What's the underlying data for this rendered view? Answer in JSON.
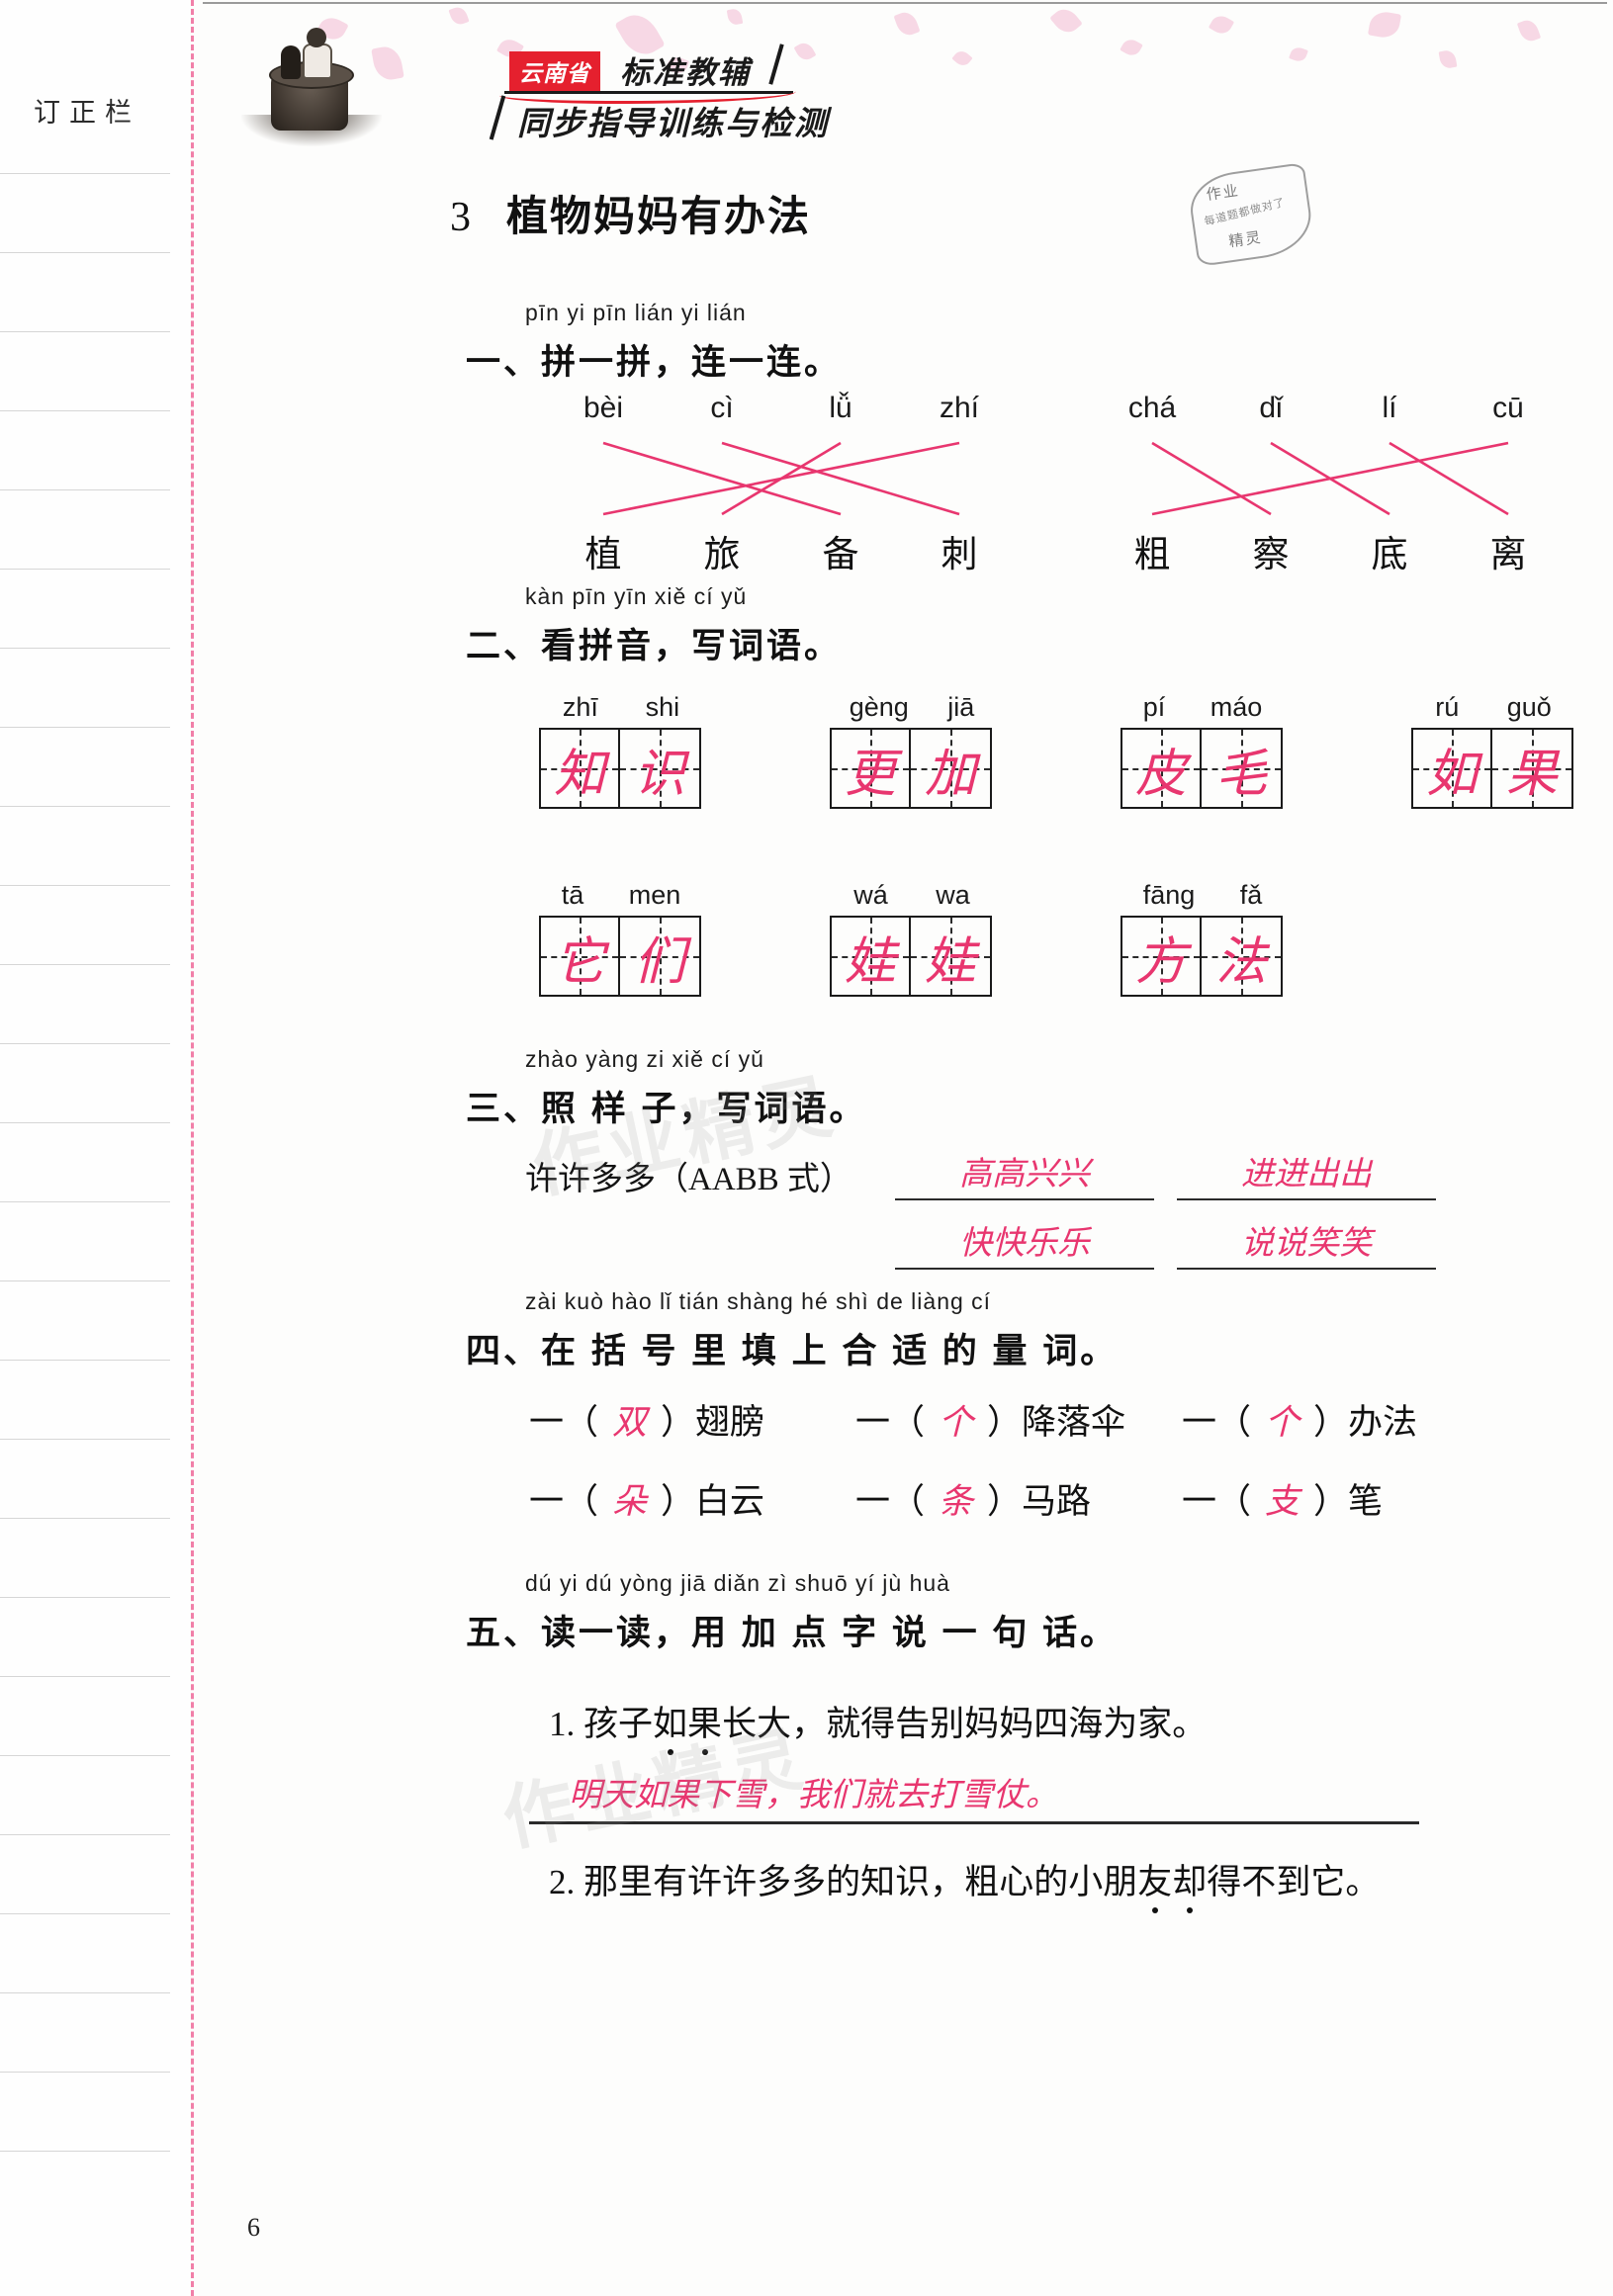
{
  "margin": {
    "title": "订正栏",
    "rule_count": 26
  },
  "header": {
    "brand_region": "云南省",
    "brand_main": "标准教辅",
    "brand_sub": "同步指导训练与检测",
    "illustration": "boy-on-tree-stump-with-cat"
  },
  "lesson": {
    "number": "3",
    "title": "植物妈妈有办法"
  },
  "stamp": {
    "line1": "作业",
    "line2": "每道题都做对了",
    "line3": "精灵"
  },
  "sections": [
    {
      "id": "one",
      "pinyin": "pīn yi pīn   lián yi lián",
      "heading": "一、拼一拼，连一连。"
    },
    {
      "id": "two",
      "pinyin": "kàn pīn yīn    xiě cí yǔ",
      "heading": "二、看拼音，写词语。"
    },
    {
      "id": "three",
      "pinyin": "zhào yàng zi    xiě cí yǔ",
      "heading": "三、照 样 子，写词语。"
    },
    {
      "id": "four",
      "pinyin": "zài kuò hào  lǐ  tián shàng hé shì de liàng cí",
      "heading": "四、在 括 号 里 填 上 合 适 的 量 词。"
    },
    {
      "id": "five",
      "pinyin": "dú yi dú     yòng jiā diǎn zì shuō yí jù huà",
      "heading": "五、读一读，用 加 点 字 说 一 句 话。"
    }
  ],
  "matching": {
    "left_pinyin": [
      "bèi",
      "cì",
      "lǚ",
      "zhí"
    ],
    "left_hanzi": [
      "植",
      "旅",
      "备",
      "刺"
    ],
    "right_pinyin": [
      "chá",
      "dǐ",
      "lí",
      "cū"
    ],
    "right_hanzi": [
      "粗",
      "察",
      "底",
      "离"
    ],
    "left_links": [
      [
        0,
        2
      ],
      [
        1,
        3
      ],
      [
        2,
        1
      ],
      [
        3,
        0
      ]
    ],
    "right_links": [
      [
        0,
        1
      ],
      [
        1,
        2
      ],
      [
        2,
        3
      ],
      [
        3,
        0
      ]
    ],
    "line_color": "#e8366f"
  },
  "word_grids": {
    "row1": [
      {
        "pinyin": [
          "zhī",
          "shi"
        ],
        "chars": [
          "知",
          "识"
        ]
      },
      {
        "pinyin": [
          "gèng",
          "jiā"
        ],
        "chars": [
          "更",
          "加"
        ]
      },
      {
        "pinyin": [
          "pí",
          "máo"
        ],
        "chars": [
          "皮",
          "毛"
        ]
      },
      {
        "pinyin": [
          "rú",
          "guǒ"
        ],
        "chars": [
          "如",
          "果"
        ]
      }
    ],
    "row2": [
      {
        "pinyin": [
          "tā",
          "men"
        ],
        "chars": [
          "它",
          "们"
        ]
      },
      {
        "pinyin": [
          "wá",
          "wa"
        ],
        "chars": [
          "娃",
          "娃"
        ]
      },
      {
        "pinyin": [
          "fāng",
          "fǎ"
        ],
        "chars": [
          "方",
          "法"
        ]
      }
    ]
  },
  "aabb": {
    "prompt": "许许多多（AABB 式）",
    "answers": [
      "高高兴兴",
      "进进出出",
      "快快乐乐",
      "说说笑笑"
    ]
  },
  "measure_words": {
    "row1": [
      {
        "prefix": "一（",
        "answer": "双",
        "suffix": "）翅膀"
      },
      {
        "prefix": "一（",
        "answer": "个",
        "suffix": "）降落伞"
      },
      {
        "prefix": "一（",
        "answer": "个",
        "suffix": "）办法"
      }
    ],
    "row2": [
      {
        "prefix": "一（",
        "answer": "朵",
        "suffix": "）白云"
      },
      {
        "prefix": "一（",
        "answer": "条",
        "suffix": "）马路"
      },
      {
        "prefix": "一（",
        "answer": "支",
        "suffix": "）笔"
      }
    ]
  },
  "sentences": [
    {
      "num": "1.",
      "text": "孩子如果长大，就得告别妈妈四海为家。",
      "answer": "明天如果下雪，我们就去打雪仗。"
    },
    {
      "num": "2.",
      "text": "那里有许许多多的知识，粗心的小朋友却得不到它。",
      "answer": ""
    }
  ],
  "watermarks": [
    "作业精灵",
    "作业精灵"
  ],
  "page_number": "6",
  "colors": {
    "handwriting": "#e8366f",
    "brand_red": "#e5202e",
    "tear_line": "#ef6a9a",
    "ink": "#111111"
  }
}
